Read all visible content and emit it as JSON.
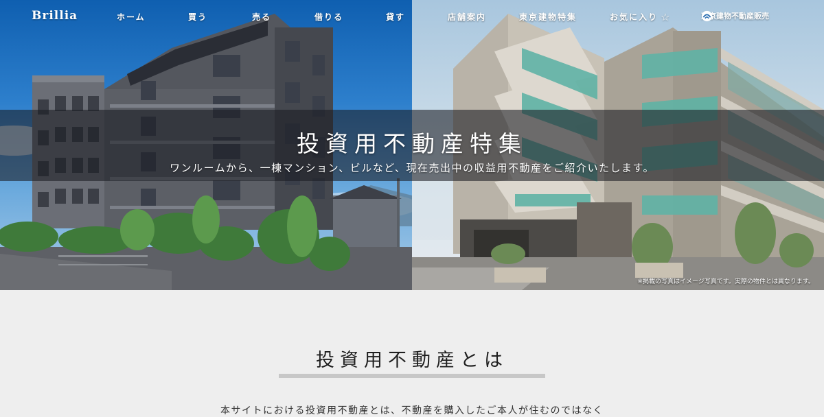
{
  "brand": {
    "logo_text": "Brillia"
  },
  "nav": {
    "items": [
      {
        "label": "ホーム"
      },
      {
        "label": "買う"
      },
      {
        "label": "売る"
      },
      {
        "label": "借りる"
      },
      {
        "label": "貸す"
      },
      {
        "label": "店舗案内"
      },
      {
        "label": "東京建物特集"
      }
    ],
    "favorites_label": "お気に入り",
    "favorites_icon": "star-outline-icon",
    "corporate_label": "東京建物不動産販売",
    "corporate_icon": "corporate-logo-icon"
  },
  "hero": {
    "title": "投資用不動産特集",
    "subtitle": "ワンルームから、一棟マンション、ビルなど、現在売出中の収益用不動産をご紹介いたします。",
    "disclaimer": "※掲載の写真はイメージ写真です。実際の物件とは異なります。"
  },
  "intro": {
    "heading": "投資用不動産とは",
    "text": "本サイトにおける投資用不動産とは、不動産を購入したご本人が住むのではなく"
  },
  "colors": {
    "sky_blue": "#2d7fcc",
    "building_gray": "#55585f",
    "glass_teal": "#5fb3a5",
    "band_overlay": "#191c23",
    "page_bg": "#eeeeee",
    "underline": "#c7c7c7"
  }
}
